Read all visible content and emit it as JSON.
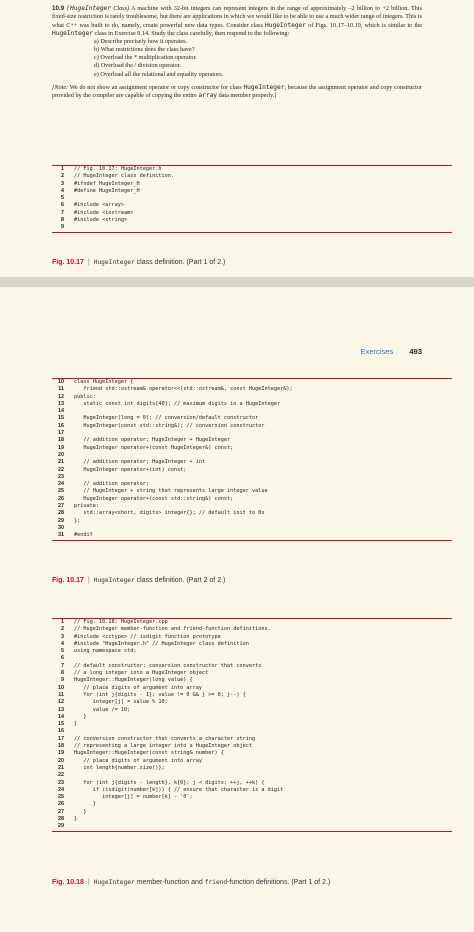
{
  "exercise": {
    "number": "10.9",
    "title_code": "(HugeInteger",
    "title_rest": " Class)",
    "p1": " A machine with 32-bit integers can represent integers in the range of approximately –2 billion to +2 billion. This fixed-size restriction is rarely troublesome, but there are applications in which we would like to be able to use a much wider range of integers. This is what C++ was built to do, namely, create powerful new data types. Consider class ",
    "p1_code": "HugeInteger",
    "p2": " of Figs. 10.17–10.19, which is similar to the ",
    "p2_code": "HugeInteger",
    "p3": " class in Exercise 9.14. Study the class carefully, then respond to the following:",
    "items": [
      "a)  Describe precisely how it operates.",
      "b)  What restrictions does the class have?",
      "c)  Overload the * multiplication operator.",
      "d)  Overload the / division operator.",
      "e)  Overload all the relational and equality operators."
    ],
    "note_label": "[Note:",
    "note_a": " We do not show an assignment operator or copy constructor for class ",
    "note_code1": "HugeInteger",
    "note_b": ", because the assignment operator and copy constructor provided by the compiler are capable of copying the entire ",
    "note_code2": "array",
    "note_c": " data member properly.]"
  },
  "fig1017a": {
    "lines": [
      {
        "n": "1",
        "t": "// Fig. 10.17: HugeInteger.h",
        "c": true
      },
      {
        "n": "2",
        "t": "// HugeInteger class definition.",
        "c": true
      },
      {
        "n": "3",
        "t": "#ifndef HugeInteger_H",
        "c": false
      },
      {
        "n": "4",
        "t": "#define HugeInteger_H",
        "c": false
      },
      {
        "n": "5",
        "t": "",
        "c": false
      },
      {
        "n": "6",
        "t": "#include <array>",
        "c": false
      },
      {
        "n": "7",
        "t": "#include <iostream>",
        "c": false
      },
      {
        "n": "8",
        "t": "#include <string>",
        "c": false
      },
      {
        "n": "9",
        "t": "",
        "c": false
      }
    ],
    "caption_fig": "Fig. 10.17",
    "caption_sep": "|",
    "caption_code": "HugeInteger",
    "caption_text": " class definition. (Part 1 of 2.)"
  },
  "page2_header": {
    "section": "Exercises",
    "page": "493"
  },
  "fig1017b": {
    "lines": [
      {
        "n": "10",
        "t": "class HugeInteger {",
        "c": false
      },
      {
        "n": "11",
        "t": "   friend std::ostream& operator<<(std::ostream&, const HugeInteger&);",
        "c": false
      },
      {
        "n": "12",
        "t": "public:",
        "c": false
      },
      {
        "n": "13",
        "t": "   static const int digits{40}; // maximum digits in a HugeInteger",
        "c": false
      },
      {
        "n": "14",
        "t": "",
        "c": false
      },
      {
        "n": "15",
        "t": "   HugeInteger(long = 0); // conversion/default constructor",
        "c": false
      },
      {
        "n": "16",
        "t": "   HugeInteger(const std::string&); // conversion constructor",
        "c": false
      },
      {
        "n": "17",
        "t": "",
        "c": false
      },
      {
        "n": "18",
        "t": "   // addition operator; HugeInteger + HugeInteger",
        "c": true
      },
      {
        "n": "19",
        "t": "   HugeInteger operator+(const HugeInteger&) const;",
        "c": false
      },
      {
        "n": "20",
        "t": "",
        "c": false
      },
      {
        "n": "21",
        "t": "   // addition operator; HugeInteger + int",
        "c": true
      },
      {
        "n": "22",
        "t": "   HugeInteger operator+(int) const;",
        "c": false
      },
      {
        "n": "23",
        "t": "",
        "c": false
      },
      {
        "n": "24",
        "t": "   // addition operator;",
        "c": true
      },
      {
        "n": "25",
        "t": "   // HugeInteger + string that represents large integer value",
        "c": true
      },
      {
        "n": "26",
        "t": "   HugeInteger operator+(const std::string&) const;",
        "c": false
      },
      {
        "n": "27",
        "t": "private:",
        "c": false
      },
      {
        "n": "28",
        "t": "   std::array<short, digits> integer{}; // default init to 0s",
        "c": false
      },
      {
        "n": "29",
        "t": "};",
        "c": false
      },
      {
        "n": "30",
        "t": "",
        "c": false
      },
      {
        "n": "31",
        "t": "#endif",
        "c": false
      }
    ],
    "caption_fig": "Fig. 10.17",
    "caption_sep": "|",
    "caption_code": "HugeInteger",
    "caption_text": " class definition. (Part 2 of 2.)"
  },
  "fig1018": {
    "lines": [
      {
        "n": "1",
        "t": "// Fig. 10.18: HugeInteger.cpp",
        "c": true
      },
      {
        "n": "2",
        "t": "// HugeInteger member-function and friend-function definitions.",
        "c": true
      },
      {
        "n": "3",
        "t": "#include <cctype> // isdigit function prototype",
        "c": false
      },
      {
        "n": "4",
        "t": "#include \"HugeInteger.h\" // HugeInteger class definition",
        "c": false
      },
      {
        "n": "5",
        "t": "using namespace std;",
        "c": false
      },
      {
        "n": "6",
        "t": "",
        "c": false
      },
      {
        "n": "7",
        "t": "// default constructor; conversion constructor that converts",
        "c": true
      },
      {
        "n": "8",
        "t": "// a long integer into a HugeInteger object",
        "c": true
      },
      {
        "n": "9",
        "t": "HugeInteger::HugeInteger(long value) {",
        "c": false
      },
      {
        "n": "10",
        "t": "   // place digits of argument into array",
        "c": true
      },
      {
        "n": "11",
        "t": "   for (int j{digits - 1}; value != 0 && j >= 0; j--) {",
        "c": false
      },
      {
        "n": "12",
        "t": "      integer[j] = value % 10;",
        "c": false
      },
      {
        "n": "13",
        "t": "      value /= 10;",
        "c": false
      },
      {
        "n": "14",
        "t": "   }",
        "c": false
      },
      {
        "n": "15",
        "t": "}",
        "c": false
      },
      {
        "n": "16",
        "t": "",
        "c": false
      },
      {
        "n": "17",
        "t": "// conversion constructor that converts a character string",
        "c": true
      },
      {
        "n": "18",
        "t": "// representing a large integer into a HugeInteger object",
        "c": true
      },
      {
        "n": "19",
        "t": "HugeInteger::HugeInteger(const string& number) {",
        "c": false
      },
      {
        "n": "20",
        "t": "   // place digits of argument into array",
        "c": true
      },
      {
        "n": "21",
        "t": "   int length{number.size()};",
        "c": false
      },
      {
        "n": "22",
        "t": "",
        "c": false
      },
      {
        "n": "23",
        "t": "   for (int j{digits - length}, k{0}; j < digits; ++j, ++k) {",
        "c": false
      },
      {
        "n": "24",
        "t": "      if (isdigit(number[k])) { // ensure that character is a digit",
        "c": false
      },
      {
        "n": "25",
        "t": "         integer[j] = number[k] - '0';",
        "c": false
      },
      {
        "n": "26",
        "t": "      }",
        "c": false
      },
      {
        "n": "27",
        "t": "   }",
        "c": false
      },
      {
        "n": "28",
        "t": "}",
        "c": false
      },
      {
        "n": "29",
        "t": "",
        "c": false
      }
    ],
    "caption_fig": "Fig. 10.18",
    "caption_sep": "|",
    "caption_code1": "HugeInteger",
    "caption_text1": " member-function and ",
    "caption_code2": "friend",
    "caption_text2": "-function definitions. (Part 1 of 2.)"
  }
}
